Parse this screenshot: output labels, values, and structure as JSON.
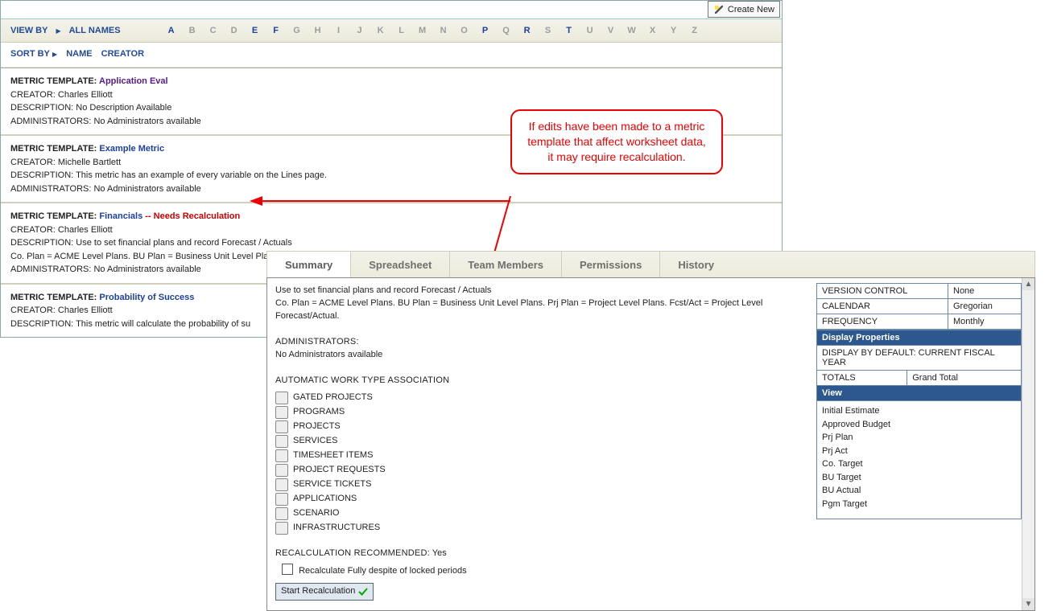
{
  "toolbar": {
    "create_label": "Create New"
  },
  "filter": {
    "view_by": "VIEW BY",
    "all": "ALL NAMES",
    "letters": [
      "A",
      "B",
      "C",
      "D",
      "E",
      "F",
      "G",
      "H",
      "I",
      "J",
      "K",
      "L",
      "M",
      "N",
      "O",
      "P",
      "Q",
      "R",
      "S",
      "T",
      "U",
      "V",
      "W",
      "X",
      "Y",
      "Z"
    ],
    "highlighted": [
      "A",
      "E",
      "F",
      "P",
      "R",
      "T"
    ]
  },
  "sort": {
    "label": "SORT BY",
    "name": "NAME",
    "creator": "CREATOR"
  },
  "labels": {
    "metric_template": "METRIC TEMPLATE:",
    "creator": "CREATOR:",
    "description": "DESCRIPTION:",
    "administrators": "ADMINISTRATORS:",
    "needs_recalc_suffix": " -- Needs Recalculation"
  },
  "templates": [
    {
      "name": "Application Eval",
      "link_color": "purple",
      "creator": "Charles Elliott",
      "description": "No Description Available",
      "administrators": "No Administrators available",
      "needs_recalc": false
    },
    {
      "name": "Example Metric",
      "link_color": "blue",
      "creator": "Michelle Bartlett",
      "description": "This metric has an example of every variable on the Lines page.",
      "administrators": "No Administrators available",
      "needs_recalc": false
    },
    {
      "name": "Financials",
      "link_color": "blue",
      "creator": "Charles Elliott",
      "description": "Use to set financial plans and record Forecast / Actuals",
      "description2": "Co. Plan = ACME Level Plans. BU Plan = Business Unit Level Plans. Prj Plan = Project Level Plans. Fcst/Act = Project Level Forecast/Actual.",
      "administrators": "No Administrators available",
      "needs_recalc": true
    },
    {
      "name": "Probability of Success",
      "link_color": "blue",
      "creator": "Charles Elliott",
      "description": "This metric will calculate the probability of su",
      "administrators": "",
      "needs_recalc": false
    }
  ],
  "tabs": [
    "Summary",
    "Spreadsheet",
    "Team Members",
    "Permissions",
    "History"
  ],
  "active_tab": 0,
  "summary": {
    "desc_line1": "Use to set financial plans and record Forecast / Actuals",
    "desc_line2": "Co. Plan = ACME Level Plans. BU Plan = Business Unit Level Plans. Prj Plan = Project Level Plans. Fcst/Act = Project Level Forecast/Actual.",
    "admins_label": "ADMINISTRATORS:",
    "admins_value": "No Administrators available",
    "auto_assoc_label": "AUTOMATIC WORK TYPE ASSOCIATION",
    "worktypes": [
      "GATED PROJECTS",
      "PROGRAMS",
      "PROJECTS",
      "SERVICES",
      "TIMESHEET ITEMS",
      "PROJECT REQUESTS",
      "SERVICE TICKETS",
      "APPLICATIONS",
      "SCENARIO",
      "INFRASTRUCTURES"
    ],
    "recalc_label": "RECALCULATION RECOMMENDED:",
    "recalc_value": "Yes",
    "recalc_checkbox_label": "Recalculate Fully despite of locked periods",
    "recalc_button": "Start Recalculation"
  },
  "side": {
    "rows": [
      {
        "k": "VERSION CONTROL",
        "v": "None"
      },
      {
        "k": "CALENDAR",
        "v": "Gregorian"
      },
      {
        "k": "FREQUENCY",
        "v": "Monthly"
      }
    ],
    "display_header": "Display Properties",
    "display_by_default": "DISPLAY BY DEFAULT:  CURRENT FISCAL YEAR",
    "totals_k": "TOTALS",
    "totals_v": "Grand Total",
    "view_header": "View",
    "views": [
      "Initial Estimate",
      "Approved Budget",
      "Prj Plan",
      "Prj Act",
      "Co. Target",
      "BU Target",
      "BU Actual",
      "Pgm Target"
    ]
  },
  "callout": {
    "text": "If edits have been made to a metric template that affect worksheet data, it may require recalculation."
  }
}
